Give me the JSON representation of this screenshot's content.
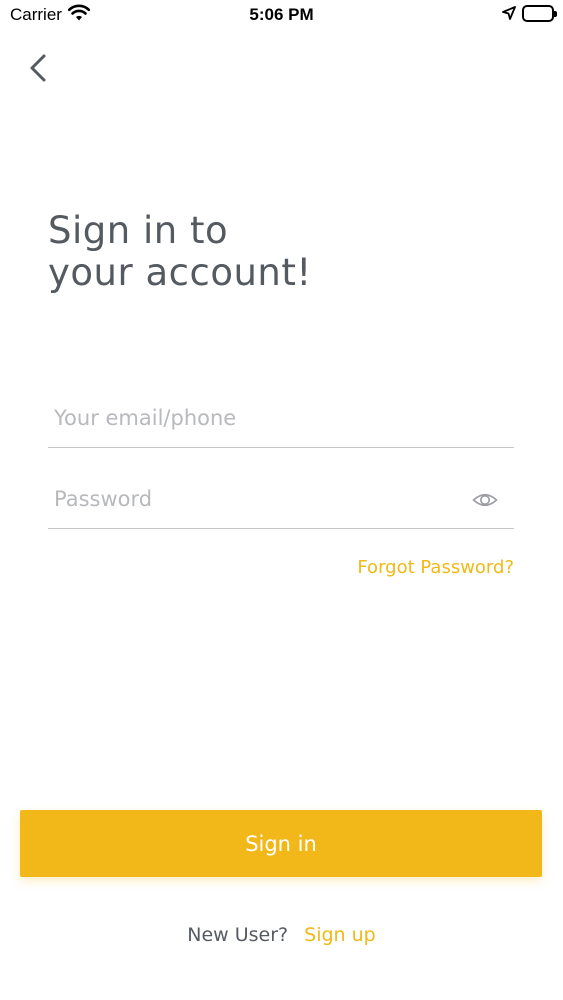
{
  "status_bar": {
    "carrier": "Carrier",
    "time": "5:06 PM",
    "wifi_icon": "wifi-icon",
    "location_icon": "location-arrow-icon",
    "battery_icon": "battery-icon",
    "battery_level": 1.0
  },
  "nav": {
    "back_icon": "chevron-left-icon"
  },
  "title": {
    "line1": "Sign in to",
    "line2": "your account!"
  },
  "form": {
    "email_placeholder": "Your email/phone",
    "email_value": "",
    "password_placeholder": "Password",
    "password_value": "",
    "password_toggle_icon": "eye-icon",
    "forgot_password_label": "Forgot Password?"
  },
  "actions": {
    "sign_in_label": "Sign in"
  },
  "footer": {
    "new_user_text": "New User?",
    "sign_up_label": "Sign up"
  },
  "colors": {
    "accent": "#f2b81a",
    "link": "#f0b916",
    "text": "#555a61",
    "placeholder": "#b7b9bc",
    "divider": "#c4c6c9"
  }
}
